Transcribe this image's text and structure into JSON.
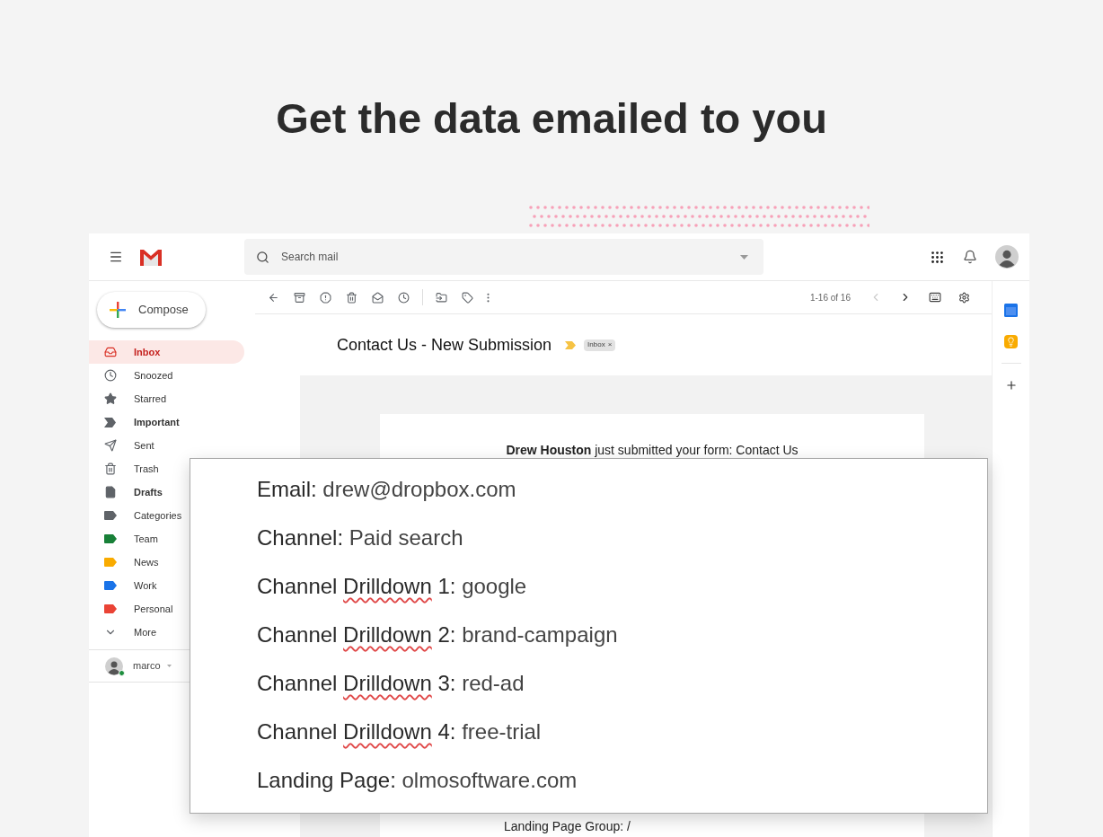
{
  "headline": "Get the data emailed to you",
  "header": {
    "search": {
      "placeholder": "Search mail"
    }
  },
  "sidebar": {
    "compose": "Compose",
    "items": [
      {
        "label": "Inbox",
        "kind": "inbox",
        "bold": true,
        "selected": true
      },
      {
        "label": "Snoozed",
        "kind": "snooze",
        "bold": false,
        "selected": false
      },
      {
        "label": "Starred",
        "kind": "star",
        "bold": false,
        "selected": false
      },
      {
        "label": "Important",
        "kind": "important",
        "bold": true,
        "selected": false
      },
      {
        "label": "Sent",
        "kind": "sent",
        "bold": false,
        "selected": false
      },
      {
        "label": "Trash",
        "kind": "trash",
        "bold": false,
        "selected": false
      },
      {
        "label": "Drafts",
        "kind": "draft",
        "bold": true,
        "selected": false
      },
      {
        "label": "Categories",
        "kind": "label",
        "color": "#5f6368",
        "bold": false,
        "selected": false
      },
      {
        "label": "Team",
        "kind": "label",
        "color": "#188038",
        "bold": false,
        "selected": false
      },
      {
        "label": "News",
        "kind": "label",
        "color": "#f9ab00",
        "bold": false,
        "selected": false
      },
      {
        "label": "Work",
        "kind": "label",
        "color": "#1a73e8",
        "bold": false,
        "selected": false
      },
      {
        "label": "Personal",
        "kind": "label",
        "color": "#ea4335",
        "bold": false,
        "selected": false
      },
      {
        "label": "More",
        "kind": "more",
        "bold": false,
        "selected": false
      }
    ],
    "account": "marco"
  },
  "toolbar": {
    "pagination": "1-16 of 16"
  },
  "message": {
    "subject": "Contact Us - New Submission",
    "tag": "Inbox",
    "tag_close": "×",
    "intro": "**Drew Houston** just submitted your form: Contact Us",
    "footer_line": "Landing Page Group: /"
  },
  "fields_card": {
    "fields": [
      {
        "label_parts": [
          {
            "text": "Email:",
            "misspelled": false
          }
        ],
        "value": "drew@dropbox.com"
      },
      {
        "label_parts": [
          {
            "text": "Channel:",
            "misspelled": false
          }
        ],
        "value": "Paid search"
      },
      {
        "label_parts": [
          {
            "text": "Channel",
            "misspelled": false
          },
          {
            "text": "Drilldown",
            "misspelled": true
          },
          {
            "text": "1:",
            "misspelled": false
          }
        ],
        "value": "google"
      },
      {
        "label_parts": [
          {
            "text": "Channel",
            "misspelled": false
          },
          {
            "text": "Drilldown",
            "misspelled": true
          },
          {
            "text": "2:",
            "misspelled": false
          }
        ],
        "value": "brand-campaign"
      },
      {
        "label_parts": [
          {
            "text": "Channel",
            "misspelled": false
          },
          {
            "text": "Drilldown",
            "misspelled": true
          },
          {
            "text": "3:",
            "misspelled": false
          }
        ],
        "value": "red-ad"
      },
      {
        "label_parts": [
          {
            "text": "Channel",
            "misspelled": false
          },
          {
            "text": "Drilldown",
            "misspelled": true
          },
          {
            "text": "4:",
            "misspelled": false
          }
        ],
        "value": "free-trial"
      },
      {
        "label_parts": [
          {
            "text": "Landing",
            "misspelled": false
          },
          {
            "text": "Page:",
            "misspelled": false
          }
        ],
        "value": "olmosoftware.com"
      }
    ]
  }
}
